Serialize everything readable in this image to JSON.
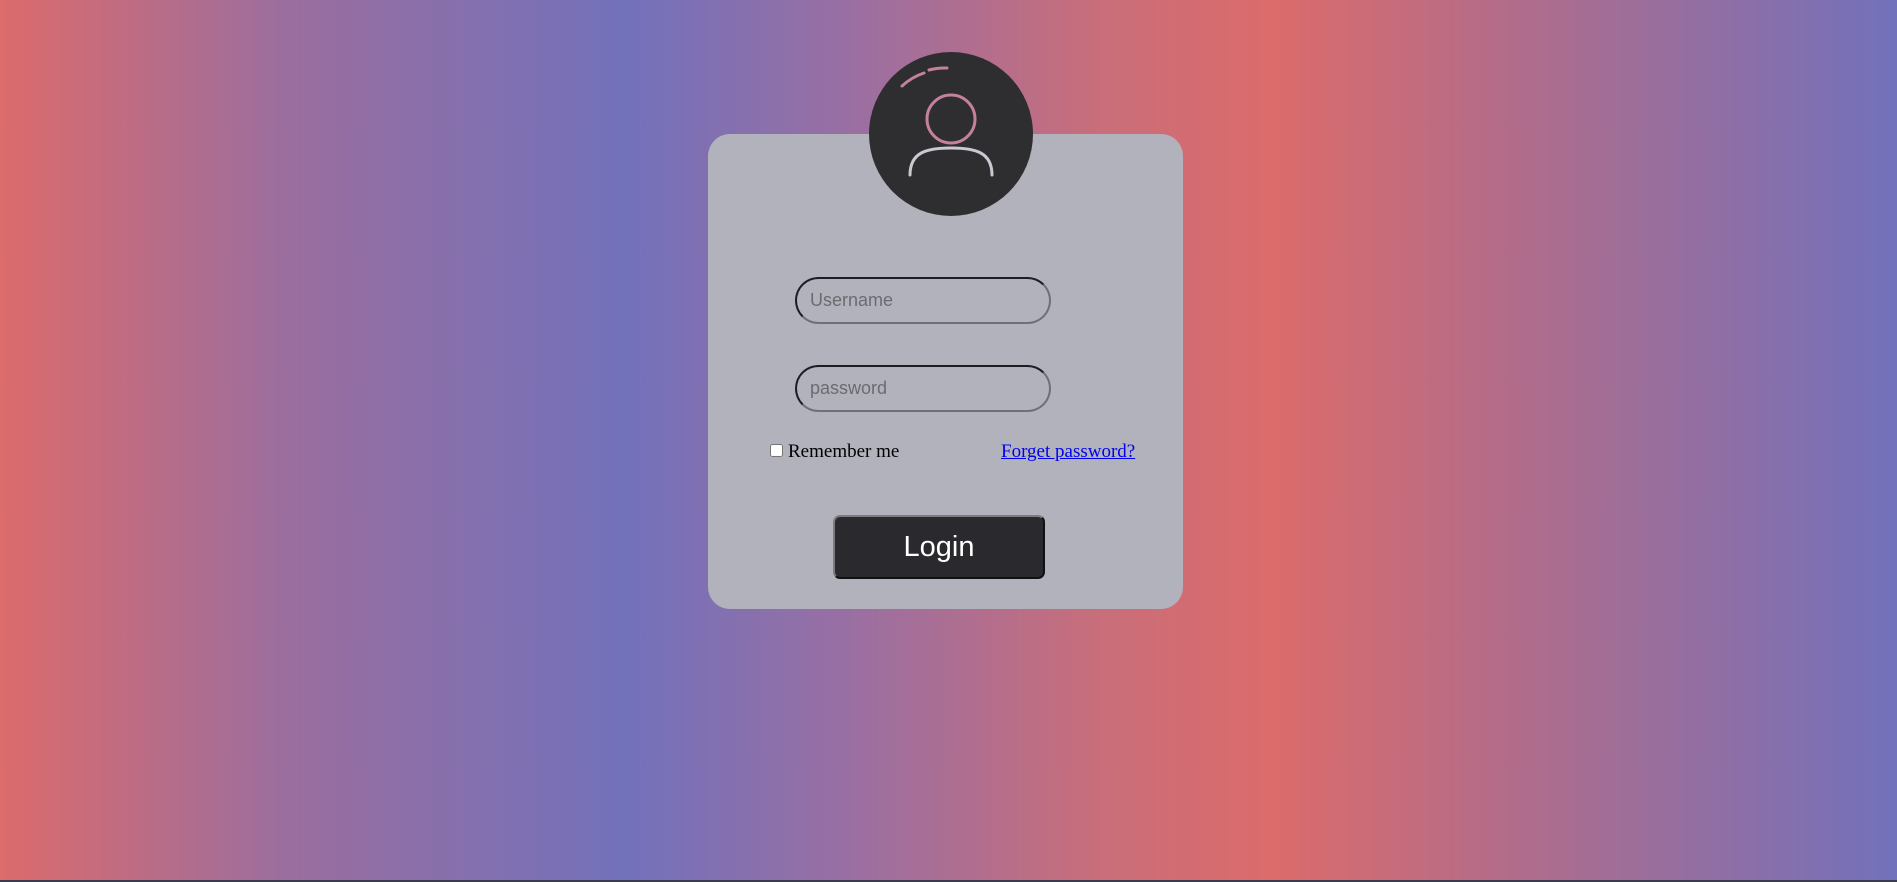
{
  "colors": {
    "card_background": "#b2b2bd",
    "avatar_background": "#2e2e30",
    "button_background": "#2a2a2e",
    "link_color": "#0000ee",
    "avatar_accent": "#c4819d"
  },
  "avatar": {
    "icon": "user-icon"
  },
  "form": {
    "username_placeholder": "Username",
    "password_placeholder": "password",
    "remember_label": "Remember me",
    "remember_checked": false,
    "forgot_link": "Forget password?",
    "login_label": "Login"
  }
}
